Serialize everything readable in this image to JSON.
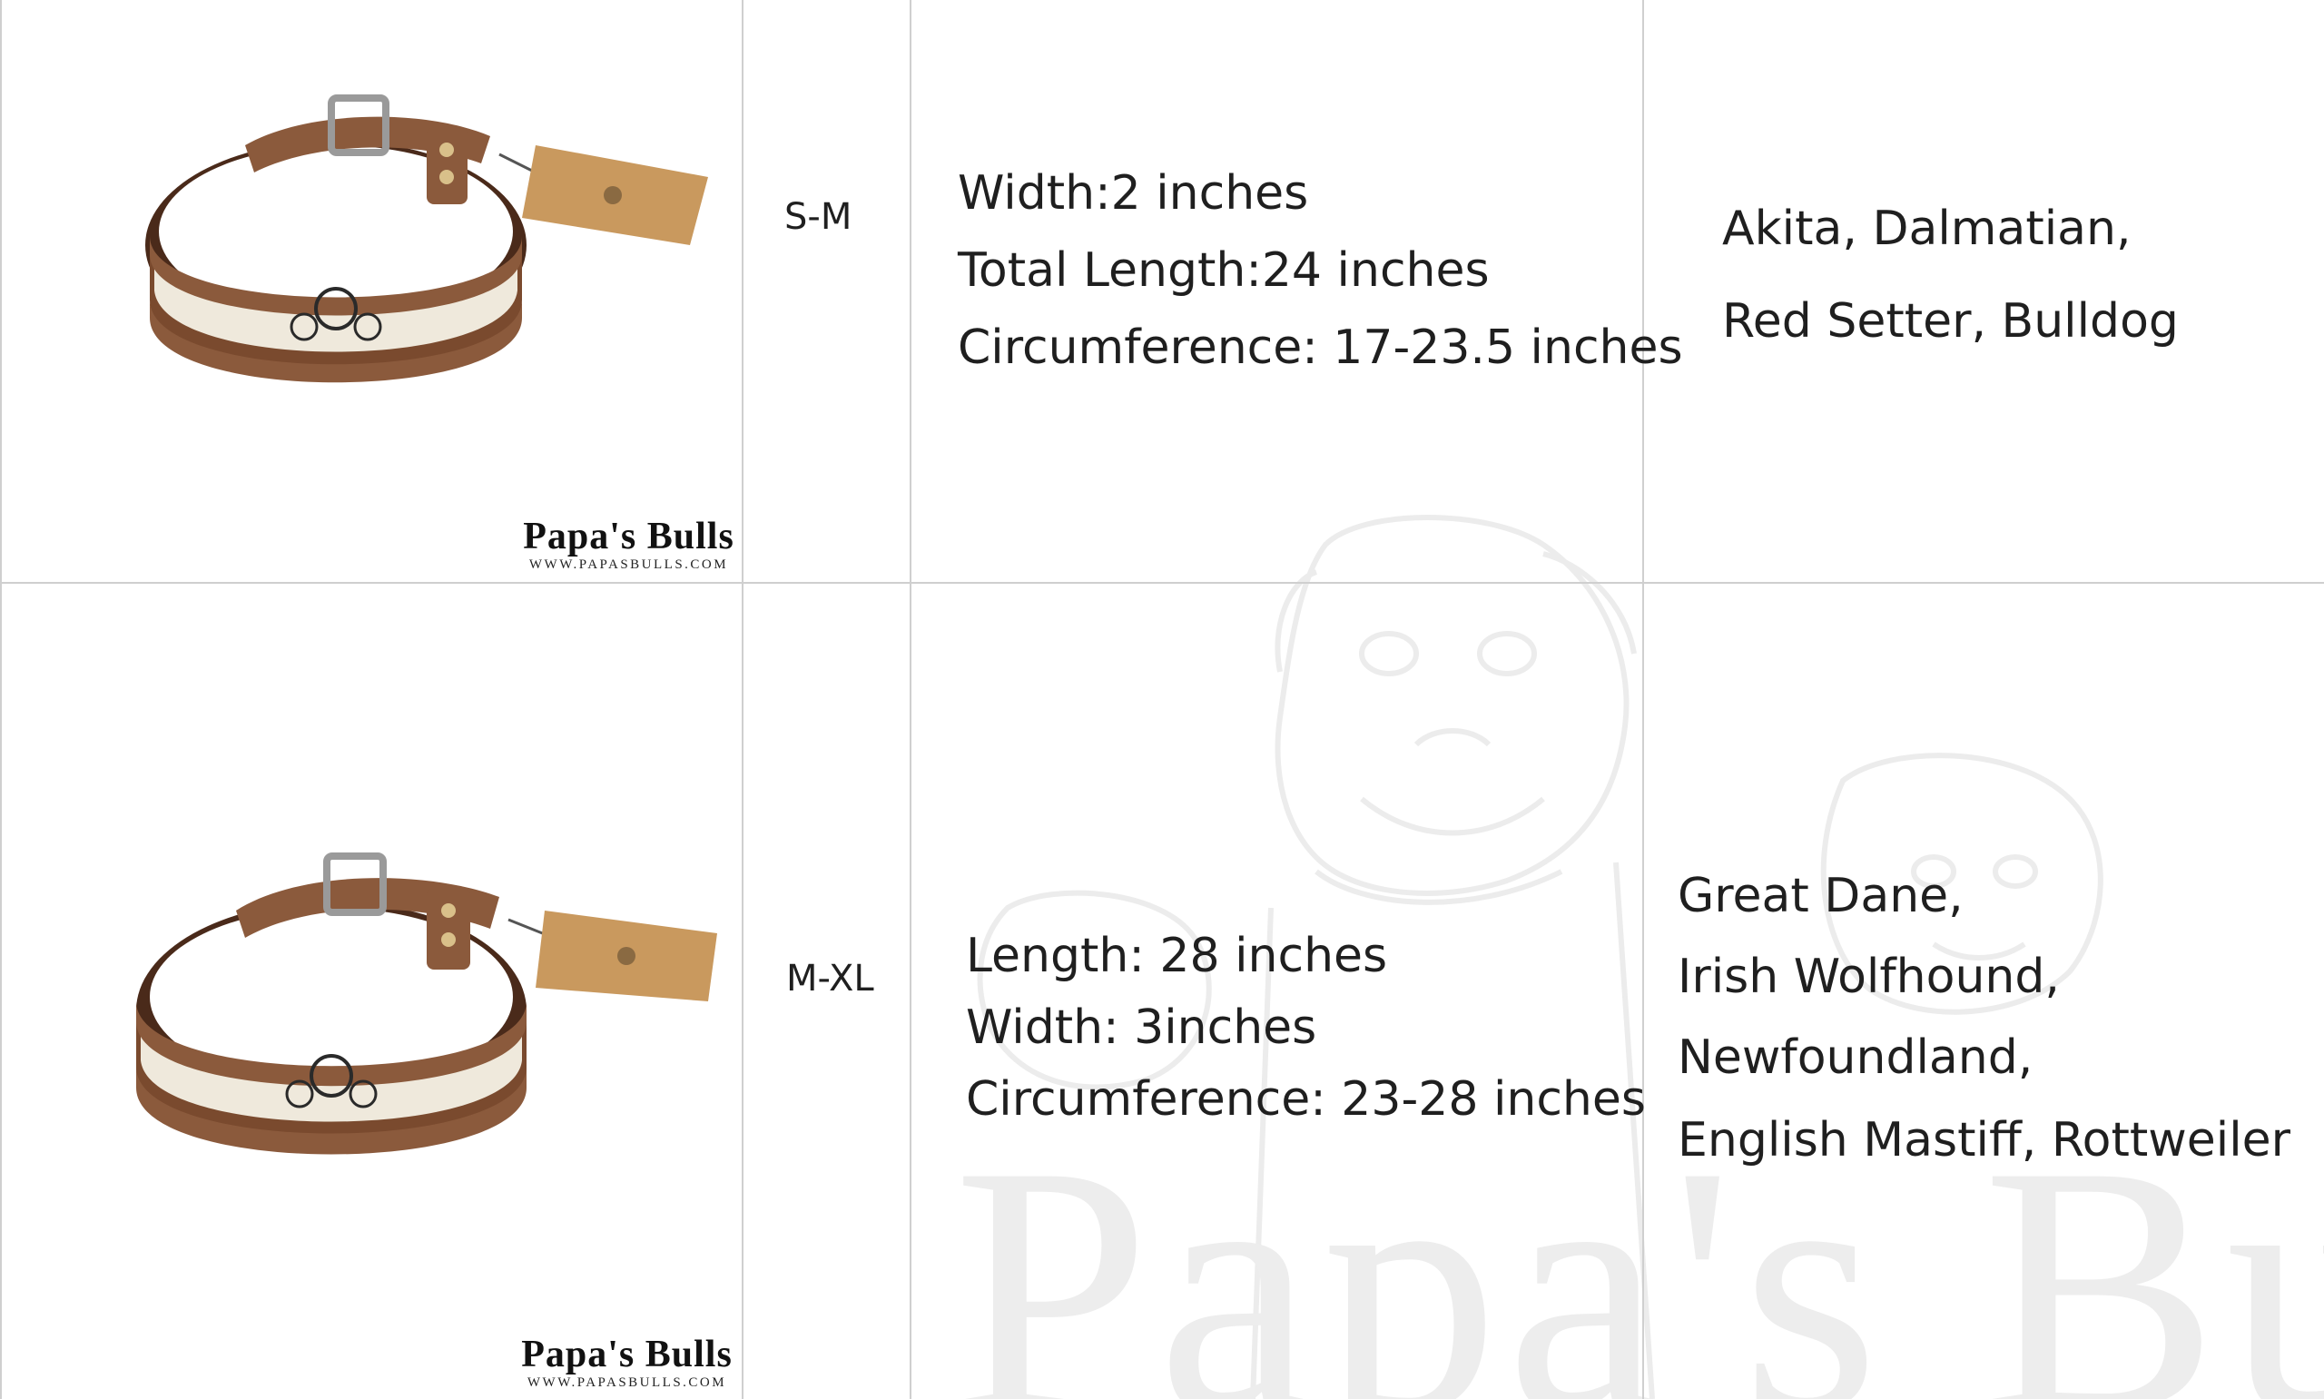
{
  "brand": {
    "logo_name_first": "Papa's",
    "logo_name_second": "Bulls",
    "logo_url": "WWW.PAPASBULLS.COM",
    "watermark_text": "Papa's Bulls"
  },
  "rows": [
    {
      "size": "S-M",
      "specs": [
        "Width:2 inches",
        "Total Length:24 inches",
        "Circumference: 17-23.5 inches"
      ],
      "breeds": [
        "Akita, Dalmatian,",
        "Red Setter, Bulldog"
      ]
    },
    {
      "size": "M-XL",
      "specs": [
        "Length: 28 inches",
        "Width: 3inches",
        "Circumference: 23-28 inches"
      ],
      "breeds": [
        "Great Dane,",
        "Irish Wolfhound,",
        "Newfoundland,",
        "English Mastiff, Rottweiler"
      ]
    }
  ],
  "colors": {
    "leather_dark": "#5a3320",
    "leather_mid": "#8b5a3c",
    "leather_light": "#a8714e",
    "canvas": "#efe9dc",
    "tag": "#c9995e",
    "grid": "#cfcfcf"
  }
}
